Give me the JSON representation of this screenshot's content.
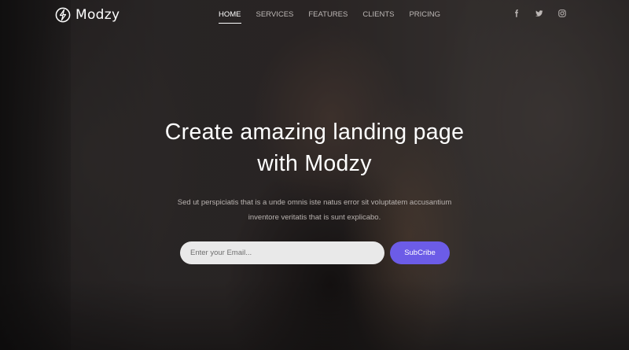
{
  "brand": {
    "name": "Modzy",
    "logo_icon": "modzy-logo-icon"
  },
  "nav": {
    "items": [
      {
        "label": "HOME",
        "active": true
      },
      {
        "label": "SERVICES",
        "active": false
      },
      {
        "label": "FEATURES",
        "active": false
      },
      {
        "label": "CLIENTS",
        "active": false
      },
      {
        "label": "PRICING",
        "active": false
      }
    ]
  },
  "socials": [
    "facebook-icon",
    "twitter-icon",
    "instagram-icon"
  ],
  "hero": {
    "title_line1": "Create amazing landing page",
    "title_line2": "with Modzy",
    "subtitle_line1": "Sed ut perspiciatis that is a unde omnis iste natus error sit voluptatem accusantium",
    "subtitle_line2": "inventore veritatis that is sunt explicabo."
  },
  "subscribe": {
    "placeholder": "Enter your Email...",
    "button_label": "SubCribe"
  },
  "colors": {
    "accent": "#6c5ce7",
    "text": "#ffffff",
    "muted": "#bdb8b6"
  }
}
